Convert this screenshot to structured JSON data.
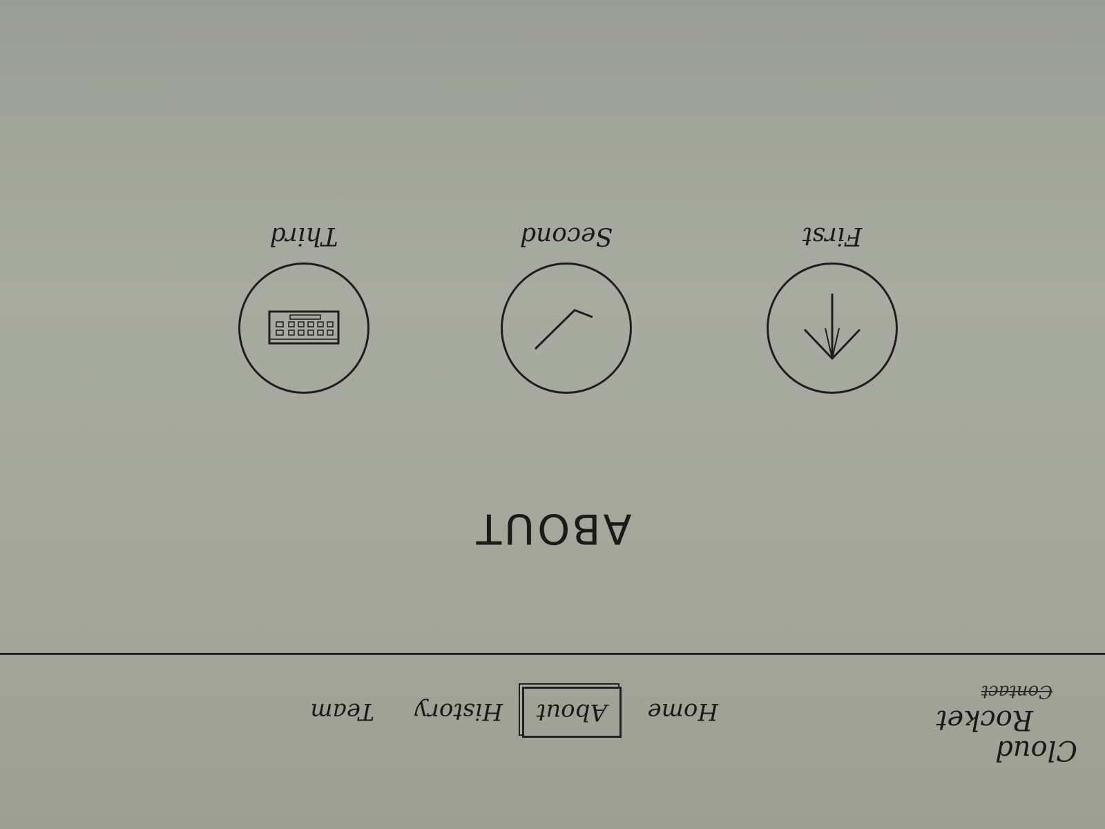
{
  "brand": {
    "line1": "Cloud",
    "line2": "Rocket"
  },
  "nav": {
    "contact": "Contact",
    "home": "Home",
    "about": "About",
    "history": "History",
    "team": "Team"
  },
  "page": {
    "title": "ABOUT"
  },
  "features": [
    {
      "label": "First",
      "icon": "arrow-up-icon"
    },
    {
      "label": "Second",
      "icon": "chevron-icon"
    },
    {
      "label": "Third",
      "icon": "keyboard-icon"
    }
  ]
}
